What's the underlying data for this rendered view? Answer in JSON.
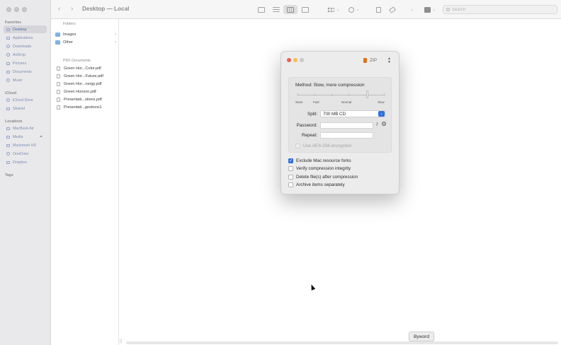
{
  "window": {
    "title": "Desktop — Local"
  },
  "toolbar": {
    "search_placeholder": "Search",
    "back_glyph": "‹",
    "forward_glyph": "›",
    "chevron": "⌄",
    "view_modes": [
      "icon-view",
      "list-view",
      "column-view",
      "gallery-view"
    ],
    "active_view": "column-view"
  },
  "sidebar": {
    "favorites_label": "Favorites",
    "favorites": [
      {
        "label": "Desktop",
        "icon": "desktop-icon",
        "active": true
      },
      {
        "label": "Applications",
        "icon": "applications-icon"
      },
      {
        "label": "Downloads",
        "icon": "downloads-icon"
      },
      {
        "label": "AirDrop",
        "icon": "airdrop-icon"
      },
      {
        "label": "Pictures",
        "icon": "pictures-icon"
      },
      {
        "label": "Documents",
        "icon": "documents-icon"
      },
      {
        "label": "Music",
        "icon": "music-icon"
      }
    ],
    "icloud_label": "iCloud",
    "icloud": [
      {
        "label": "iCloud Drive",
        "icon": "cloud-icon"
      },
      {
        "label": "Shared",
        "icon": "shared-folder-icon"
      }
    ],
    "locations_label": "Locations",
    "locations": [
      {
        "label": "MacBook Air",
        "icon": "laptop-icon"
      },
      {
        "label": "Media",
        "icon": "disk-icon"
      },
      {
        "label": "Macintosh HD",
        "icon": "disk-icon"
      },
      {
        "label": "OneDrive",
        "icon": "cloud-icon"
      },
      {
        "label": "Dropbox",
        "icon": "dropbox-icon"
      }
    ],
    "tags_label": "Tags"
  },
  "column": {
    "folders_header": "Folders",
    "folders": [
      "Images",
      "Other"
    ],
    "pdf_header": "PDF Documents",
    "pdfs": [
      "Green Hor...Color.pdf",
      "Green Hor...Future.pdf",
      "Green Hor...nergy.pdf",
      "Green Horizon.pdf",
      "Presentati...stions.pdf",
      "Presentati...gestions1"
    ],
    "chevron": "›"
  },
  "dialog": {
    "format": "ZIP",
    "method_label": "Method: Slow, more compression",
    "slider": {
      "value": 0.8,
      "labels": [
        "Store",
        "Fast",
        "Normal",
        "Slow"
      ]
    },
    "split_label": "Split:",
    "split_value": "700 MB CD",
    "password_label": "Password:",
    "password_value": "",
    "repeat_label": "Repeat:",
    "repeat_value": "",
    "aes_label": "Use AES-256 encryption",
    "options": [
      {
        "label": "Exclude Mac resource forks",
        "checked": true
      },
      {
        "label": "Verify compression integrity",
        "checked": false
      },
      {
        "label": "Delete file(s) after compression",
        "checked": false
      },
      {
        "label": "Archive items separately",
        "checked": false
      }
    ],
    "check_glyph": "✓",
    "colors": {
      "close": "#ed5f57",
      "minimize": "#f5be4f",
      "zoom": "#c9c9c9",
      "accent": "#2f6fe0"
    }
  },
  "tooltip": {
    "text": "Byword"
  }
}
